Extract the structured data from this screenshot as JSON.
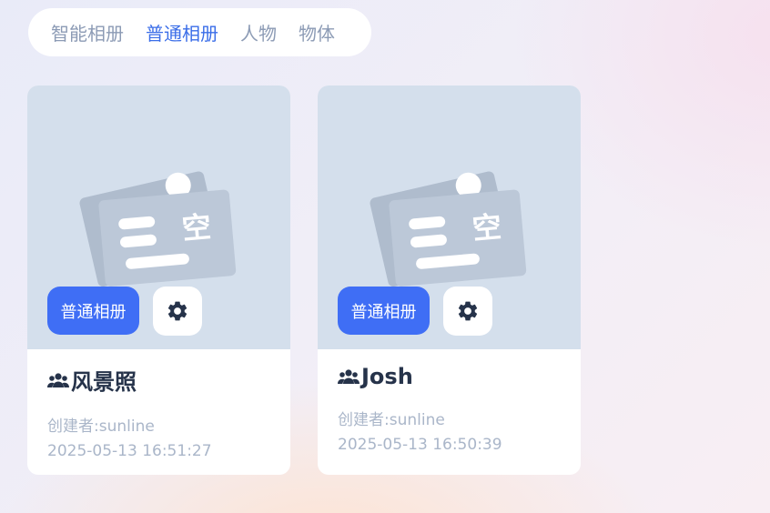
{
  "tabs": [
    {
      "label": "智能相册",
      "active": false
    },
    {
      "label": "普通相册",
      "active": true
    },
    {
      "label": "人物",
      "active": false
    },
    {
      "label": "物体",
      "active": false
    }
  ],
  "illustration_text": "空",
  "albums": [
    {
      "type_badge": "普通相册",
      "title": "风景照",
      "creator": "创建者:sunline",
      "created_at": "2025-05-13 16:51:27",
      "title_icon": "people-icon",
      "settings_icon": "gear-icon"
    },
    {
      "type_badge": "普通相册",
      "title": "Josh",
      "creator": "创建者:sunline",
      "created_at": "2025-05-13 16:50:39",
      "title_icon": "people-icon",
      "settings_icon": "gear-icon"
    }
  ],
  "colors": {
    "accent": "#3f6ef5",
    "active_tab": "#3b6ee8",
    "inactive_tab": "#8c9bb5",
    "cover_bg": "#d4dfec",
    "title_text": "#26334a",
    "meta_text": "#aab6c9"
  }
}
